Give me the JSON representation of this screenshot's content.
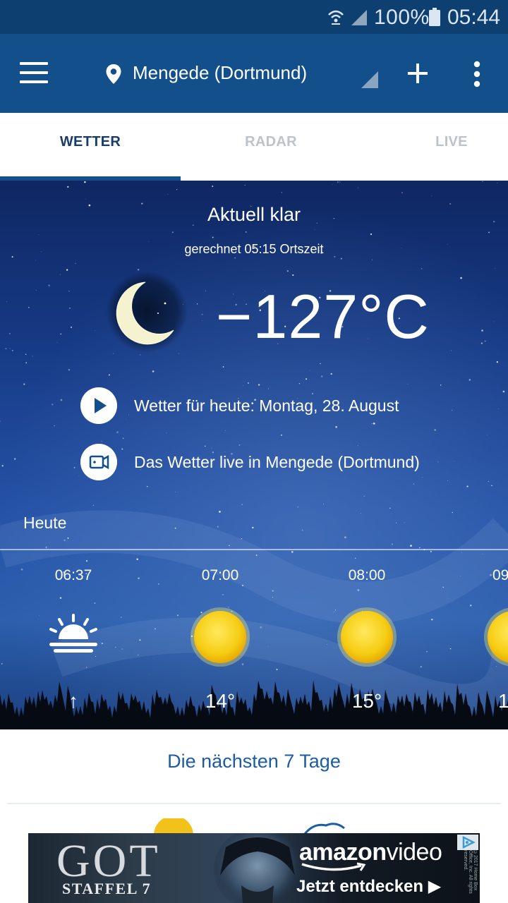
{
  "status_bar": {
    "battery": "100%",
    "time": "05:44",
    "wifi_icon": "wifi-calling-icon",
    "signal_icon": "signal-icon",
    "battery_icon": "battery-icon"
  },
  "app_bar": {
    "location": "Mengede (Dortmund)",
    "menu_icon": "hamburger-menu-icon",
    "location_icon": "map-pin-icon",
    "add_icon": "plus-icon",
    "more_icon": "more-vertical-icon"
  },
  "tabs": [
    {
      "label": "WETTER",
      "active": true
    },
    {
      "label": "RADAR",
      "active": false
    },
    {
      "label": "LIVE",
      "active": false
    }
  ],
  "current": {
    "condition": "Aktuell klar",
    "calculated": "gerechnet 05:15 Ortszeit",
    "temperature": "−127°C",
    "icon": "moon-icon"
  },
  "links": [
    {
      "label": "Wetter für heute: Montag, 28. August",
      "icon": "play-icon"
    },
    {
      "label": "Das Wetter live in Mengede (Dortmund)",
      "icon": "video-camera-icon"
    }
  ],
  "today": {
    "label": "Heute",
    "hours": [
      {
        "time": "06:37",
        "icon": "sunrise-icon",
        "value": "↑"
      },
      {
        "time": "07:00",
        "icon": "sun-icon",
        "value": "14°"
      },
      {
        "time": "08:00",
        "icon": "sun-icon",
        "value": "15°"
      },
      {
        "time": "09",
        "icon": "sun-icon",
        "value": "1"
      }
    ]
  },
  "next_days": {
    "label": "Die nächsten 7 Tage"
  },
  "ad": {
    "title": "GOT",
    "subtitle": "STAFFEL 7",
    "brand": "amazon",
    "brand_suffix": "video",
    "cta": "Jetzt entdecken ▶",
    "copyright": "©2017 Home Box Office, Inc. All rights reserved."
  },
  "colors": {
    "status_bar": "#0d3f71",
    "app_bar": "#134f8a",
    "tab_active": "#163d6b",
    "tab_inactive": "#bcc3cb",
    "link_blue": "#1b5ca4"
  }
}
